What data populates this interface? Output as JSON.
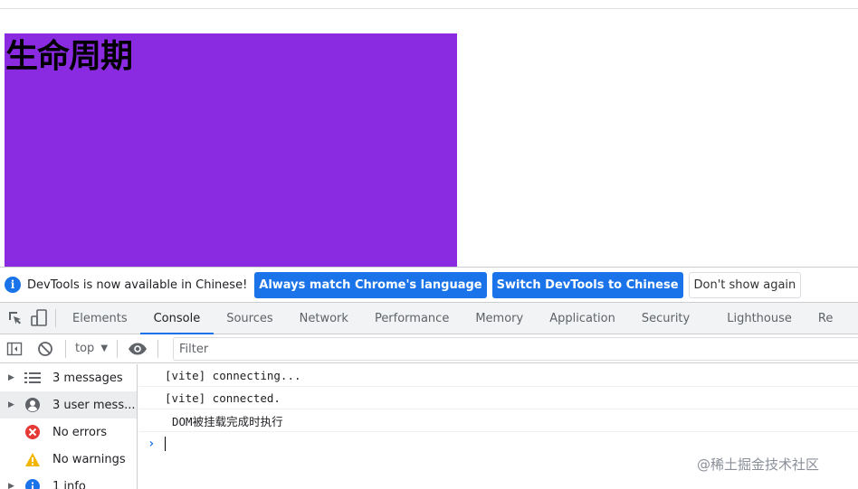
{
  "page": {
    "heading": "生命周期",
    "box_color": "#8a2be2"
  },
  "infobar": {
    "icon": "info-icon",
    "icon_glyph": "i",
    "message": "DevTools is now available in Chinese!",
    "btn_match": "Always match Chrome's language",
    "btn_switch": "Switch DevTools to Chinese",
    "btn_dismiss": "Don't show again",
    "accent": "#1a73e8"
  },
  "tabs": [
    {
      "label": "Elements"
    },
    {
      "label": "Console",
      "active": true
    },
    {
      "label": "Sources"
    },
    {
      "label": "Network"
    },
    {
      "label": "Performance"
    },
    {
      "label": "Memory"
    },
    {
      "label": "Application"
    },
    {
      "label": "Security"
    },
    {
      "label": "Lighthouse"
    },
    {
      "label": "Re"
    }
  ],
  "console_toolbar": {
    "context": "top",
    "context_caret": "▼",
    "filter_placeholder": "Filter"
  },
  "sidebar": {
    "items": [
      {
        "label": "3 messages",
        "icon": "list-icon"
      },
      {
        "label": "3 user mess...",
        "icon": "user-icon"
      },
      {
        "label": "No errors",
        "icon": "error-icon"
      },
      {
        "label": "No warnings",
        "icon": "warning-icon"
      },
      {
        "label": "1 info",
        "icon": "info-icon"
      }
    ],
    "caret": "▶"
  },
  "messages": [
    "[vite] connecting...",
    "[vite] connected.",
    "DOM被挂载完成时执行"
  ],
  "prompt_glyph": "›",
  "watermark": "@稀土掘金技术社区"
}
